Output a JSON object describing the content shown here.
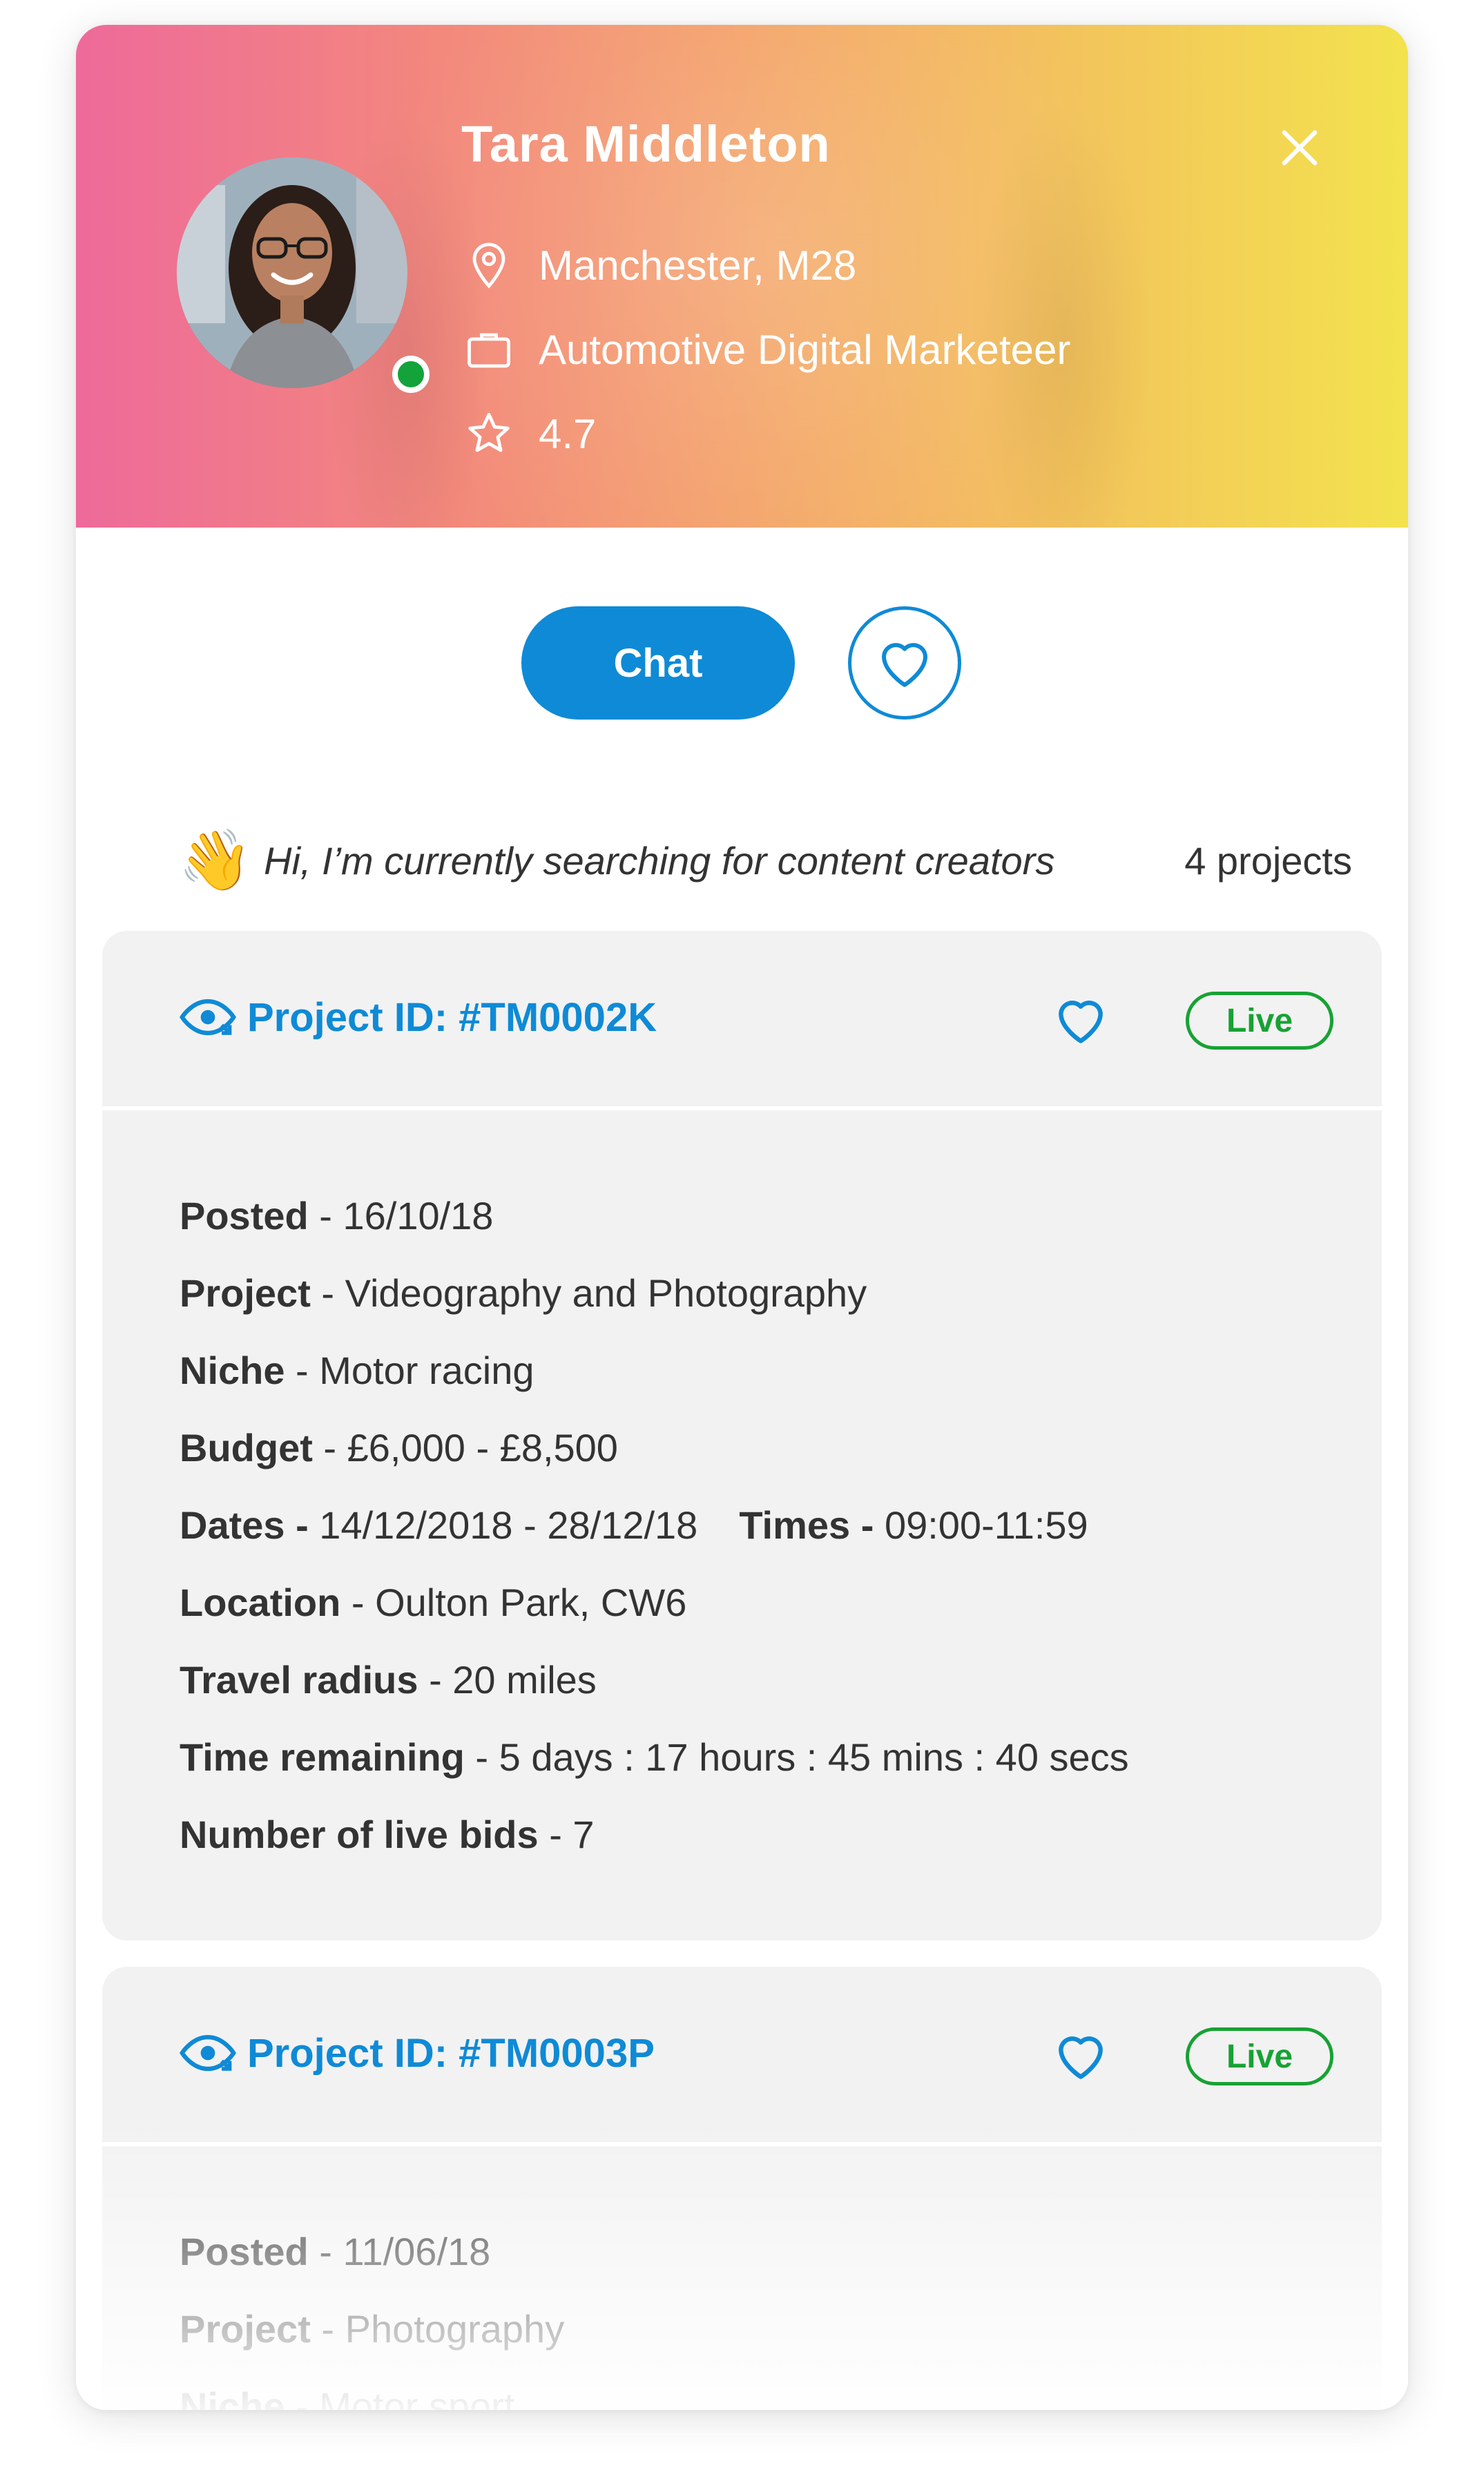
{
  "profile": {
    "name": "Tara Middleton",
    "location": "Manchester, M28",
    "role": "Automotive Digital Marketeer",
    "rating": "4.7",
    "status_color": "#13a33a"
  },
  "icons": {
    "location": "map-pin-icon",
    "role": "briefcase-icon",
    "rating": "star-icon",
    "close": "close-icon",
    "favourite": "heart-icon",
    "view": "eye-icon"
  },
  "actions": {
    "chat_label": "Chat"
  },
  "intro": {
    "emoji": "👋",
    "message": "Hi, I’m currently searching for content creators",
    "project_count": "4 projects"
  },
  "colors": {
    "accent": "#0f8ad6",
    "live": "#17a233"
  },
  "projects": [
    {
      "id_label": "Project ID: #TM0002K",
      "status": "Live",
      "details": [
        {
          "label": "Posted",
          "value": " - 16/10/18"
        },
        {
          "label": "Project",
          "value": " - Videography and Photography"
        },
        {
          "label": "Niche",
          "value": " - Motor racing"
        },
        {
          "label": "Budget",
          "value": " - £6,000 - £8,500"
        },
        {
          "label": "Dates - ",
          "value": "14/12/2018 - 28/12/18",
          "label2": "Times - ",
          "value2": "09:00-11:59"
        },
        {
          "label": "Location",
          "value": " - Oulton Park, CW6"
        },
        {
          "label": "Travel radius",
          "value": " - 20 miles"
        },
        {
          "label": "Time remaining",
          "value": " - 5 days : 17 hours : 45 mins : 40 secs"
        },
        {
          "label": "Number of live bids",
          "value": " - 7"
        }
      ]
    },
    {
      "id_label": "Project ID: #TM0003P",
      "status": "Live",
      "details": [
        {
          "label": "Posted",
          "value": " - 11/06/18"
        },
        {
          "label": "Project",
          "value": " - Photography"
        },
        {
          "label": "Niche",
          "value": " - Motor sport"
        }
      ]
    }
  ]
}
